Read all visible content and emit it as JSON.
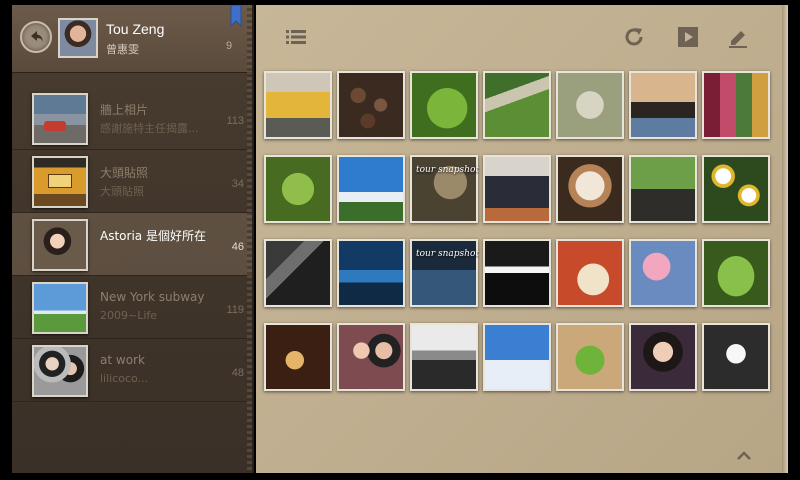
{
  "profile": {
    "name": "Tou Zeng",
    "subtitle": "曾惠雯",
    "count": "9"
  },
  "albums": [
    {
      "title": "牆上相片",
      "subtitle": "感謝施特主任揭露...",
      "count": "113",
      "active": false
    },
    {
      "title": "大頭貼照",
      "subtitle": "大頭貼照",
      "count": "34",
      "active": false
    },
    {
      "title": "Astoria 是個好所在",
      "subtitle": "",
      "count": "46",
      "active": true
    },
    {
      "title": "New York subway",
      "subtitle": "2009~Life",
      "count": "119",
      "active": false
    },
    {
      "title": "at work",
      "subtitle": "lilicoco...",
      "count": "48",
      "active": false
    }
  ],
  "toolbar": {
    "menu_icon": "list-icon",
    "refresh_icon": "refresh-icon",
    "play_icon": "play-icon",
    "edit_icon": "pencil-icon"
  },
  "photos": [
    "yellow train",
    "macarons",
    "green leaf",
    "garden path",
    "blurred leaves",
    "woman at desk",
    "colorful glass",
    "green plants",
    "blue sky",
    "blurred shapes",
    "person sitting",
    "latte",
    "green plant",
    "daisies",
    "dark shadows",
    "water boats",
    "tour snapshot",
    "dark room",
    "sandwich plate",
    "pink blossoms",
    "garden",
    "birthday cake",
    "woman with child",
    "city skyline",
    "clouds",
    "salad",
    "woman smiling",
    "snapshot sign"
  ],
  "photo_overlay_text": [
    {
      "index": 9,
      "text": "tour snapshot"
    },
    {
      "index": 16,
      "text": "tour snapshot"
    }
  ],
  "colors": {
    "sidebar": "#4a3d31",
    "paper": "#c3b394",
    "active_text": "#ffffff"
  }
}
